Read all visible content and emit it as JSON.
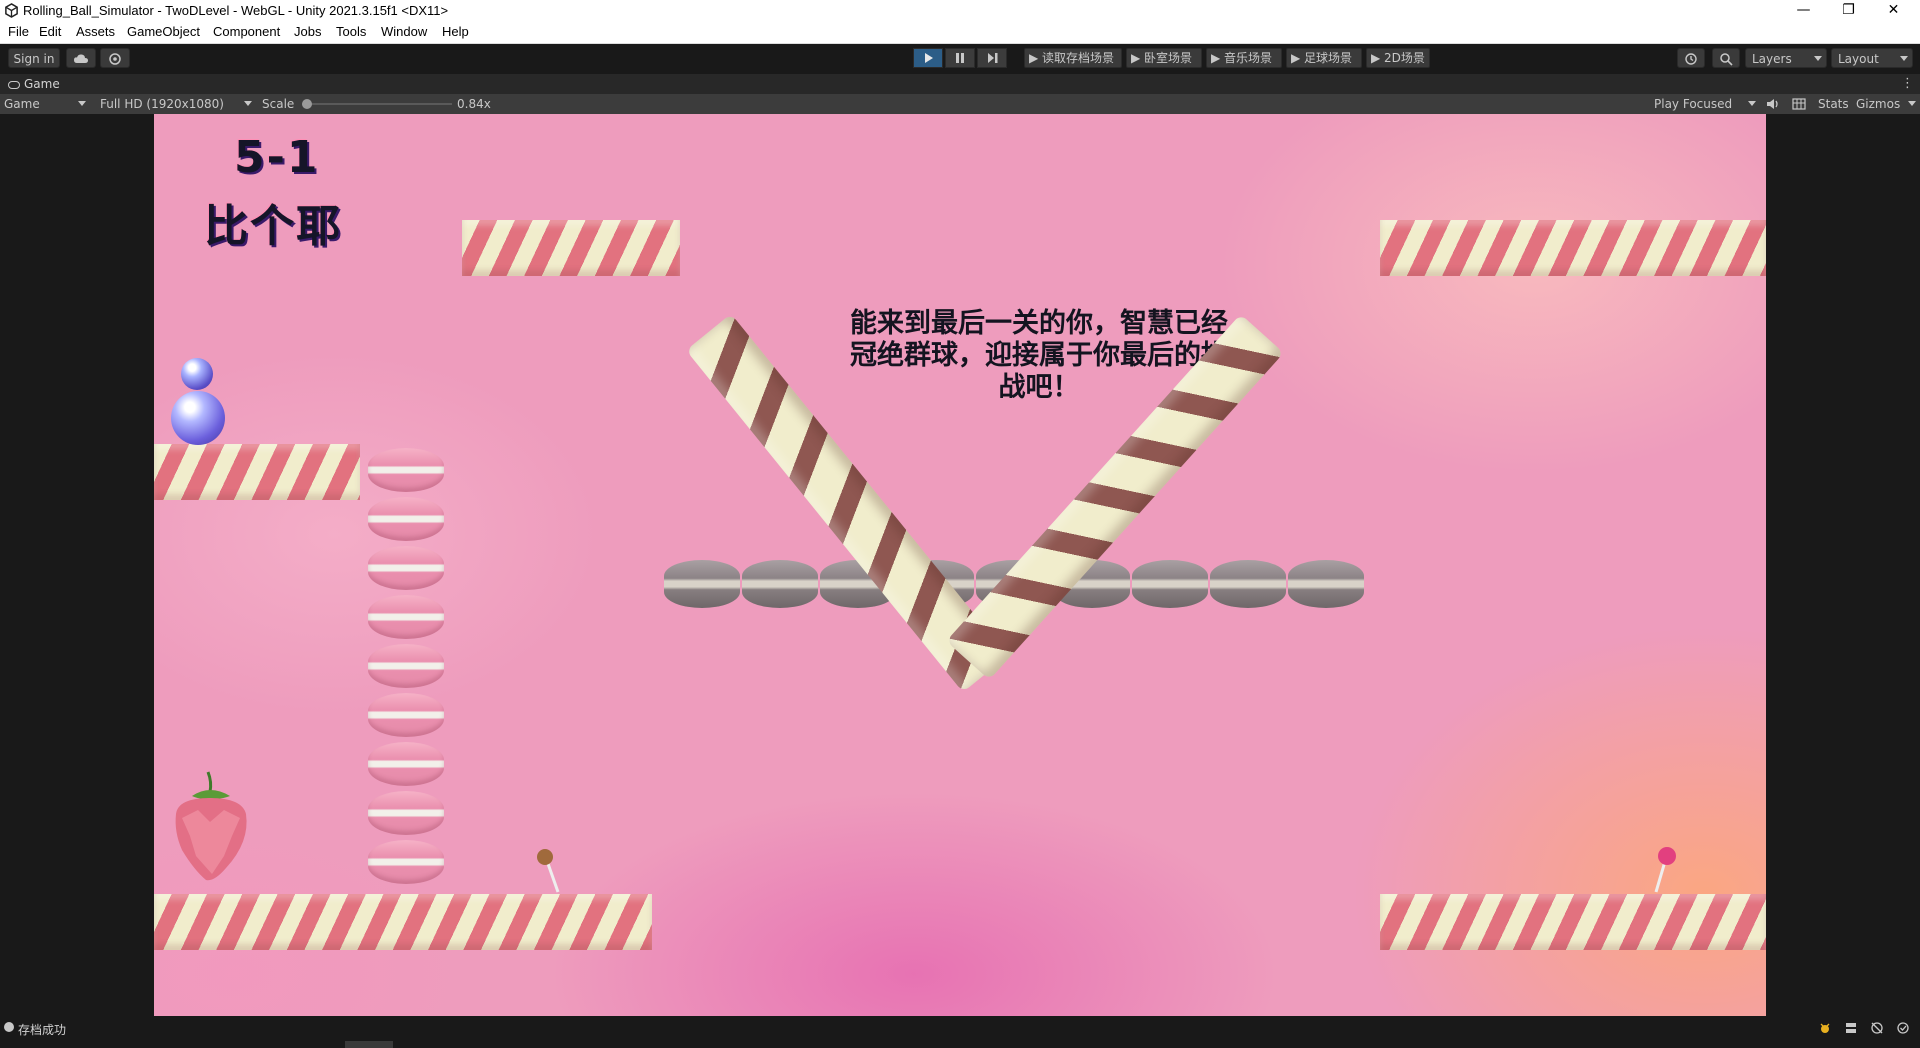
{
  "window": {
    "title": "Rolling_Ball_Simulator - TwoDLevel - WebGL - Unity 2021.3.15f1 <DX11>",
    "controls": [
      "—",
      "❐",
      "✕"
    ]
  },
  "menu": [
    "File",
    "Edit",
    "Assets",
    "GameObject",
    "Component",
    "Jobs",
    "Tools",
    "Window",
    "Help"
  ],
  "toolbar": {
    "sign_in": "Sign in",
    "scene_buttons": [
      "▶ 读取存档场景",
      "▶ 卧室场景",
      "▶ 音乐场景",
      "▶ 足球场景",
      "▶ 2D场景"
    ],
    "layers": "Layers",
    "layout": "Layout",
    "play_active": true,
    "accent": "#2c5d87"
  },
  "game_tab": {
    "tab_label": "Game",
    "display": "Game",
    "resolution": "Full HD (1920x1080)",
    "scale_label": "Scale",
    "scale_value": "0.84x",
    "play_mode": "Play Focused",
    "stats": "Stats",
    "gizmos": "Gizmos"
  },
  "game": {
    "level_number": "5-1",
    "level_name": "比个耶",
    "message": "能来到最后一关的你，智慧已经冠绝群球，迎接属于你最后的挑战吧！",
    "colors": {
      "stripe_light": "#f1edcc",
      "stripe_red": "#e2727f",
      "candy_brown": "#8f5751",
      "background": "#ee9cbd"
    }
  },
  "status": {
    "message": "存档成功"
  }
}
